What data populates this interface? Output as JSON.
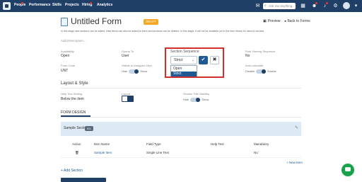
{
  "nav": {
    "items": [
      "People",
      "Performance",
      "Skills",
      "Projects",
      "Hiring",
      "Analytics"
    ],
    "search_placeholder": "Ask me anything..."
  },
  "header": {
    "title": "Untitled Form",
    "badge": "DRAFT",
    "preview": "Preview",
    "back": "Back to Forms"
  },
  "description": "In this stage new sections can be added. New items can also be added to them and sections can be deleted. In this stage, it will not be available yet in the form library for users to access.",
  "desc_placeholder": "Add Description...",
  "fields": {
    "availability_label": "Availability",
    "availability_value": "Open",
    "opens_to_label": "Opens To",
    "opens_to_value": "User",
    "section_sequence_label": "Section Sequence",
    "role_label": "Role Viewing Sequence",
    "role_value": "No",
    "form_code_label": "Form Code",
    "form_code_value": "UNT",
    "visible_label": "Visible to Assigned User",
    "visible_hide": "Hide",
    "visible_show": "Show",
    "autocalc_label": "Auto-calculate",
    "autocalc_disable": "Disable",
    "autocalc_enable": "Enable"
  },
  "select": {
    "value": "Strict",
    "options": [
      "Open",
      "Strict"
    ]
  },
  "layout": {
    "title": "Layout & Style",
    "help_label": "Help Text Setting",
    "help_value": "Below the item",
    "layout_label": "Layout",
    "section_title_label": "Section Title Visibility",
    "section_hide": "Hide",
    "section_show": "Show"
  },
  "tab": "FORM DESIGN",
  "section": {
    "name": "Sample Section",
    "badge": "0/1"
  },
  "table": {
    "headers": [
      "Action",
      "Item Name",
      "Field Type",
      "Help Text",
      "Mandatory"
    ],
    "row": {
      "item": "Sample Item",
      "type": "Single Line Text",
      "help": "",
      "mandatory": "No"
    }
  },
  "new_item": "+ New Item",
  "add_section": "+ Add Section"
}
